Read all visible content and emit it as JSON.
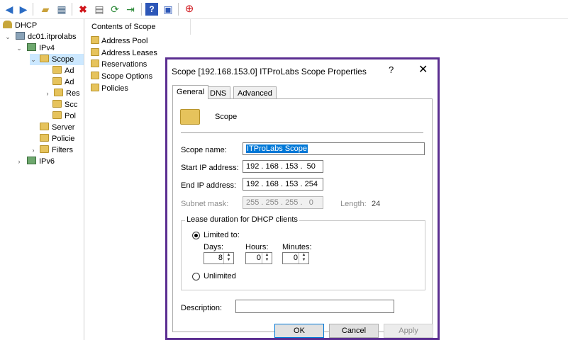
{
  "toolbar": {
    "buttons": [
      {
        "name": "back-icon",
        "glyph": "🡄"
      },
      {
        "name": "forward-icon",
        "glyph": "🡆"
      },
      {
        "name": "up-folder-icon",
        "glyph": "⬆"
      },
      {
        "name": "show-hide-tree-icon",
        "glyph": "▦"
      },
      {
        "name": "delete-icon",
        "glyph": "✖"
      },
      {
        "name": "properties-icon",
        "glyph": "▤"
      },
      {
        "name": "refresh-icon",
        "glyph": "⟳"
      },
      {
        "name": "export-list-icon",
        "glyph": "⇥"
      },
      {
        "name": "help-icon",
        "glyph": "?"
      },
      {
        "name": "view-icon",
        "glyph": "▣"
      },
      {
        "name": "deactivate-icon",
        "glyph": "⬇"
      }
    ],
    "colors": {
      "nav": "#2b6cc4",
      "delete": "#d0161c",
      "deactivate": "#d0161c",
      "help": "#2d57b8"
    }
  },
  "tree": {
    "dhcp": "DHCP",
    "server": "dc01.itprolabs",
    "ipv4": "IPv4",
    "scope": "Scope",
    "child1": "Ad",
    "child2": "Ad",
    "child3": "Res",
    "child4": "Scc",
    "child5": "Pol",
    "server_options": "Server",
    "policies": "Policie",
    "filters": "Filters",
    "ipv6": "IPv6"
  },
  "content": {
    "header": "Contents of Scope",
    "items": [
      "Address Pool",
      "Address Leases",
      "Reservations",
      "Scope Options",
      "Policies"
    ]
  },
  "dialog": {
    "title": "Scope [192.168.153.0] ITProLabs Scope Properties",
    "help": "?",
    "close": "✕",
    "tabs": [
      "General",
      "DNS",
      "Advanced"
    ],
    "heading": "Scope",
    "scope_name_label": "Scope name:",
    "scope_name_value": "ITProLabs Scope",
    "start_ip_label": "Start IP address:",
    "start_ip": [
      "192",
      "168",
      "153",
      "50"
    ],
    "end_ip_label": "End IP address:",
    "end_ip": [
      "192",
      "168",
      "153",
      "254"
    ],
    "subnet_label": "Subnet mask:",
    "subnet": [
      "255",
      "255",
      "255",
      "0"
    ],
    "length_label": "Length:",
    "length_value": "24",
    "lease_group": "Lease duration for DHCP clients",
    "limited_label": "Limited to:",
    "days_label": "Days:",
    "days_value": "8",
    "hours_label": "Hours:",
    "hours_value": "0",
    "minutes_label": "Minutes:",
    "minutes_value": "0",
    "unlimited_label": "Unlimited",
    "description_label": "Description:",
    "description_value": "",
    "ok": "OK",
    "cancel": "Cancel",
    "apply": "Apply",
    "border_color": "#5b2e91"
  }
}
